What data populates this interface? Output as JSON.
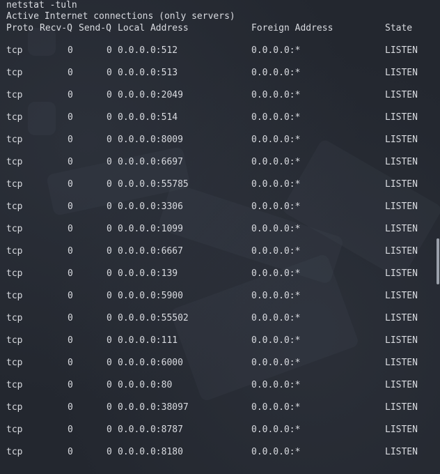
{
  "terminal": {
    "command": "netstat -tuln",
    "heading": "Active Internet connections (only servers)",
    "columns": {
      "proto": "Proto",
      "recv_q": "Recv-Q",
      "send_q": "Send-Q",
      "local": "Local Address",
      "foreign": "Foreign Address",
      "state": "State"
    },
    "rows": [
      {
        "proto": "tcp",
        "recv_q": "0",
        "send_q": "0",
        "local": "0.0.0.0:512",
        "foreign": "0.0.0.0:*",
        "state": "LISTEN"
      },
      {
        "proto": "tcp",
        "recv_q": "0",
        "send_q": "0",
        "local": "0.0.0.0:513",
        "foreign": "0.0.0.0:*",
        "state": "LISTEN"
      },
      {
        "proto": "tcp",
        "recv_q": "0",
        "send_q": "0",
        "local": "0.0.0.0:2049",
        "foreign": "0.0.0.0:*",
        "state": "LISTEN"
      },
      {
        "proto": "tcp",
        "recv_q": "0",
        "send_q": "0",
        "local": "0.0.0.0:514",
        "foreign": "0.0.0.0:*",
        "state": "LISTEN"
      },
      {
        "proto": "tcp",
        "recv_q": "0",
        "send_q": "0",
        "local": "0.0.0.0:8009",
        "foreign": "0.0.0.0:*",
        "state": "LISTEN"
      },
      {
        "proto": "tcp",
        "recv_q": "0",
        "send_q": "0",
        "local": "0.0.0.0:6697",
        "foreign": "0.0.0.0:*",
        "state": "LISTEN"
      },
      {
        "proto": "tcp",
        "recv_q": "0",
        "send_q": "0",
        "local": "0.0.0.0:55785",
        "foreign": "0.0.0.0:*",
        "state": "LISTEN"
      },
      {
        "proto": "tcp",
        "recv_q": "0",
        "send_q": "0",
        "local": "0.0.0.0:3306",
        "foreign": "0.0.0.0:*",
        "state": "LISTEN"
      },
      {
        "proto": "tcp",
        "recv_q": "0",
        "send_q": "0",
        "local": "0.0.0.0:1099",
        "foreign": "0.0.0.0:*",
        "state": "LISTEN"
      },
      {
        "proto": "tcp",
        "recv_q": "0",
        "send_q": "0",
        "local": "0.0.0.0:6667",
        "foreign": "0.0.0.0:*",
        "state": "LISTEN"
      },
      {
        "proto": "tcp",
        "recv_q": "0",
        "send_q": "0",
        "local": "0.0.0.0:139",
        "foreign": "0.0.0.0:*",
        "state": "LISTEN"
      },
      {
        "proto": "tcp",
        "recv_q": "0",
        "send_q": "0",
        "local": "0.0.0.0:5900",
        "foreign": "0.0.0.0:*",
        "state": "LISTEN"
      },
      {
        "proto": "tcp",
        "recv_q": "0",
        "send_q": "0",
        "local": "0.0.0.0:55502",
        "foreign": "0.0.0.0:*",
        "state": "LISTEN"
      },
      {
        "proto": "tcp",
        "recv_q": "0",
        "send_q": "0",
        "local": "0.0.0.0:111",
        "foreign": "0.0.0.0:*",
        "state": "LISTEN"
      },
      {
        "proto": "tcp",
        "recv_q": "0",
        "send_q": "0",
        "local": "0.0.0.0:6000",
        "foreign": "0.0.0.0:*",
        "state": "LISTEN"
      },
      {
        "proto": "tcp",
        "recv_q": "0",
        "send_q": "0",
        "local": "0.0.0.0:80",
        "foreign": "0.0.0.0:*",
        "state": "LISTEN"
      },
      {
        "proto": "tcp",
        "recv_q": "0",
        "send_q": "0",
        "local": "0.0.0.0:38097",
        "foreign": "0.0.0.0:*",
        "state": "LISTEN"
      },
      {
        "proto": "tcp",
        "recv_q": "0",
        "send_q": "0",
        "local": "0.0.0.0:8787",
        "foreign": "0.0.0.0:*",
        "state": "LISTEN"
      },
      {
        "proto": "tcp",
        "recv_q": "0",
        "send_q": "0",
        "local": "0.0.0.0:8180",
        "foreign": "0.0.0.0:*",
        "state": "LISTEN"
      }
    ]
  },
  "colors": {
    "background": "#23272f",
    "text": "#d9dbe0",
    "scrollbar_thumb": "#9aa0aa"
  }
}
